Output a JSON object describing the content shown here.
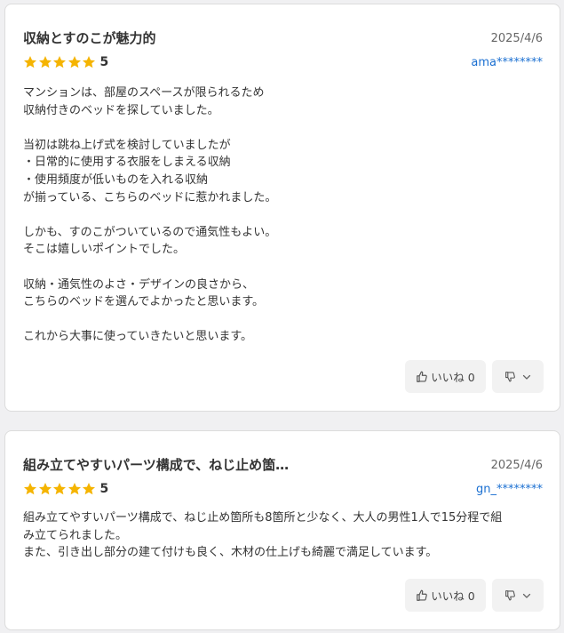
{
  "reviews": [
    {
      "title": "収納とすのこが魅力的",
      "date": "2025/4/6",
      "rating": 5,
      "rating_text": "5",
      "user": "ama********",
      "body": "マンションは、部屋のスペースが限られるため\n収納付きのベッドを探していました。\n\n当初は跳ね上げ式を検討していましたが\n・日常的に使用する衣服をしまえる収納\n・使用頻度が低いものを入れる収納\nが揃っている、こちらのベッドに惹かれました。\n\nしかも、すのこがついているので通気性もよい。\nそこは嬉しいポイントでした。\n\n収納・通気性のよさ・デザインの良さから、\nこちらのベッドを選んでよかったと思います。\n\nこれから大事に使っていきたいと思います。",
      "like_label": "いいね 0"
    },
    {
      "title": "組み立てやすいパーツ構成で、ねじ止め箇…",
      "date": "2025/4/6",
      "rating": 5,
      "rating_text": "5",
      "user": "gn_********",
      "body": "組み立てやすいパーツ構成で、ねじ止め箇所も8箇所と少なく、大人の男性1人で15分程で組\nみ立てられました。\nまた、引き出し部分の建て付けも良く、木材の仕上げも綺麗で満足しています。",
      "like_label": "いいね 0"
    }
  ],
  "colors": {
    "star": "#f5b400",
    "user_link": "#1a6fd1",
    "button_bg": "#f2f2f2"
  },
  "icons": {
    "star": "star-icon",
    "like": "thumbs-up-icon",
    "dislike": "thumbs-down-icon",
    "dropdown": "chevron-down-icon"
  }
}
